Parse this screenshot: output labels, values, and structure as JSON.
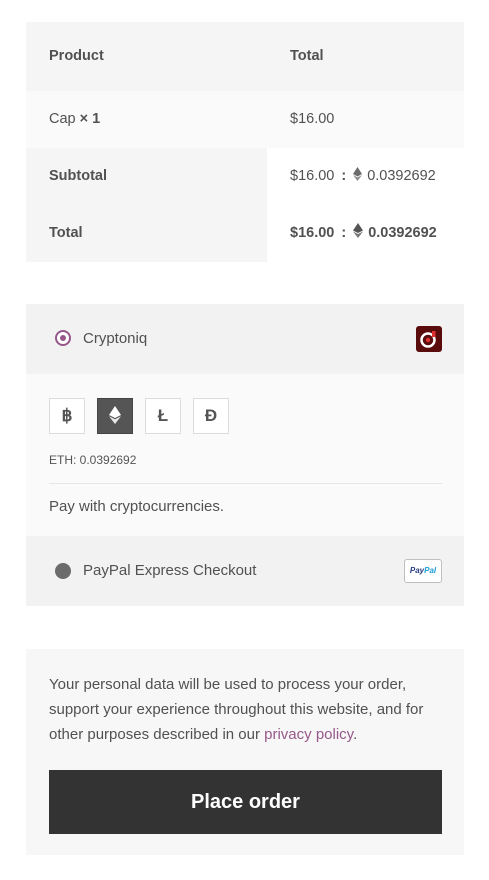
{
  "order": {
    "header": {
      "product": "Product",
      "total": "Total"
    },
    "item": {
      "name": "Cap",
      "qty": "× 1",
      "total": "$16.00"
    },
    "subtotal": {
      "label": "Subtotal",
      "fiat": "$16.00",
      "separator": ":",
      "crypto": "0.0392692"
    },
    "total": {
      "label": "Total",
      "fiat": "$16.00",
      "separator": ":",
      "crypto": "0.0392692"
    }
  },
  "payment": {
    "cryptoniq": {
      "label": "Cryptoniq",
      "logo_icon": "cryptoniq-logo-icon",
      "coins": [
        {
          "symbol": "฿",
          "icon": "bitcoin-icon",
          "active": false
        },
        {
          "symbol": "⬩",
          "icon": "ethereum-icon",
          "active": true
        },
        {
          "symbol": "Ł",
          "icon": "litecoin-icon",
          "active": false
        },
        {
          "symbol": "Đ",
          "icon": "dogecoin-icon",
          "active": false
        }
      ],
      "amount_text": "ETH: 0.0392692",
      "description": "Pay with cryptocurrencies."
    },
    "paypal": {
      "label": "PayPal Express Checkout",
      "logo_text_pay": "Pay",
      "logo_text_pal": "Pal"
    }
  },
  "terms": {
    "text_before": "Your personal data will be used to process your order, support your experience throughout this website, and for other purposes described in our ",
    "link": "privacy policy",
    "text_after": "."
  },
  "place_order_label": "Place order",
  "colors": {
    "accent": "#96588a",
    "button": "#333333"
  }
}
